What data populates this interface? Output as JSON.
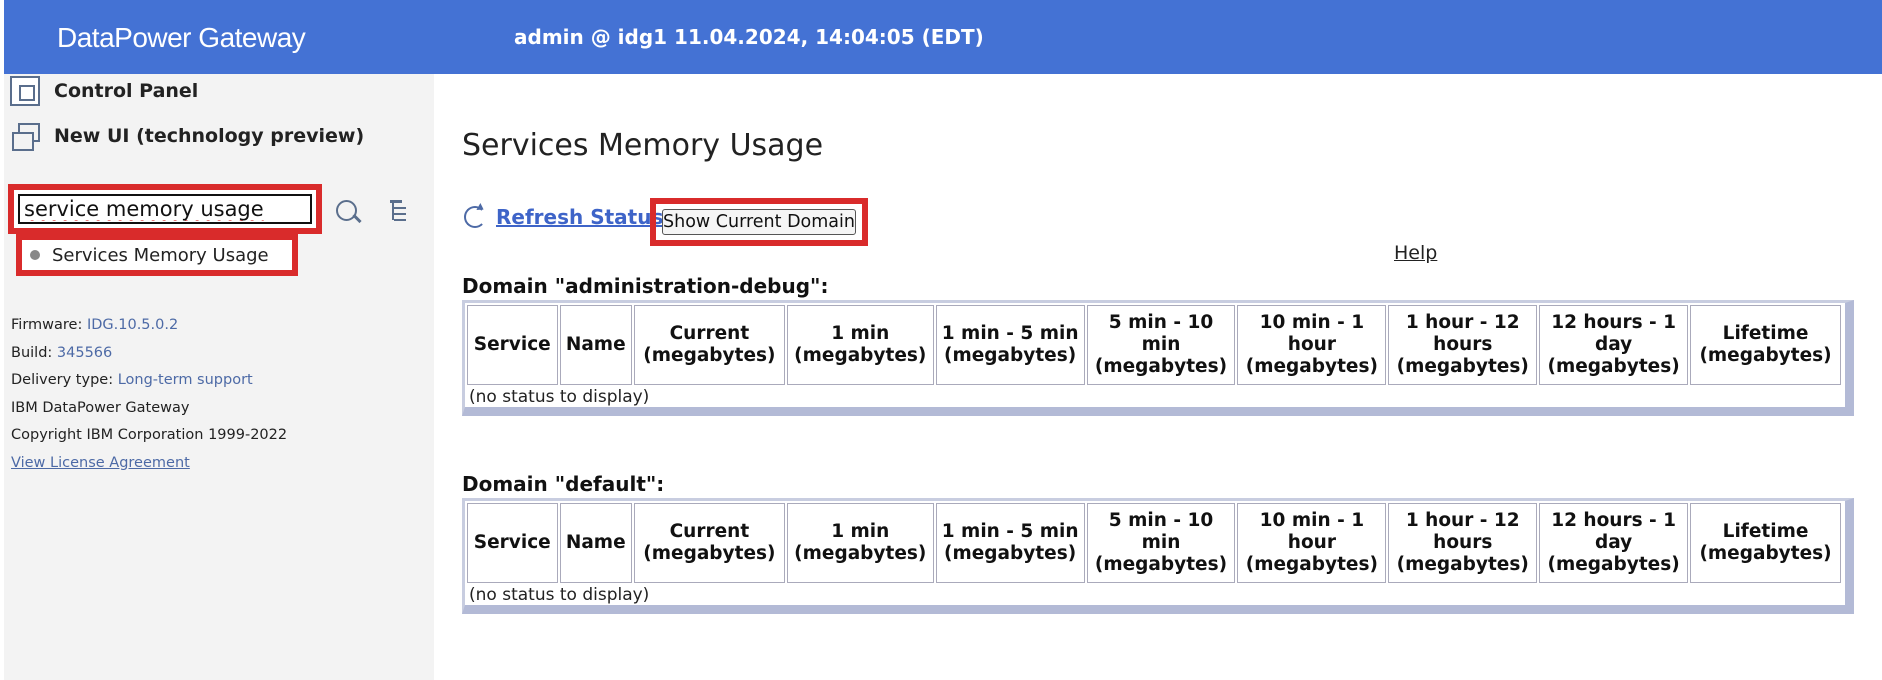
{
  "header": {
    "product": "DataPower Gateway",
    "session": "admin @ idg1 11.04.2024, 14:04:05 (EDT)"
  },
  "sidebar": {
    "control_panel": "Control Panel",
    "new_ui": "New UI (technology preview)",
    "search": {
      "value": "service memory usage"
    },
    "search_result": "Services Memory Usage",
    "info": {
      "firmware_label": "Firmware:",
      "firmware_value": "IDG.10.5.0.2",
      "build_label": "Build:",
      "build_value": "345566",
      "delivery_label": "Delivery type:",
      "delivery_value": "Long-term support",
      "product_line": "IBM DataPower Gateway",
      "copyright": "Copyright IBM Corporation 1999-2022",
      "license_link": "View License Agreement"
    }
  },
  "main": {
    "title": "Services Memory Usage",
    "refresh_label": "Refresh Status",
    "show_domain_label": "Show Current Domain",
    "help_label": "Help",
    "columns": [
      "Service",
      "Name",
      "Current (megabytes)",
      "1 min (megabytes)",
      "1 min - 5 min (megabytes)",
      "5 min - 10 min (megabytes)",
      "10 min - 1 hour (megabytes)",
      "1 hour - 12 hours (megabytes)",
      "12 hours - 1 day (megabytes)",
      "Lifetime (megabytes)"
    ],
    "domains": [
      {
        "label": "Domain \"administration-debug\":",
        "empty_text": "(no status to display)"
      },
      {
        "label": "Domain \"default\":",
        "empty_text": "(no status to display)"
      }
    ]
  },
  "colors": {
    "header_bg": "#4472d4",
    "highlight_red": "#d92b2b",
    "link_blue": "#3e64c8"
  }
}
